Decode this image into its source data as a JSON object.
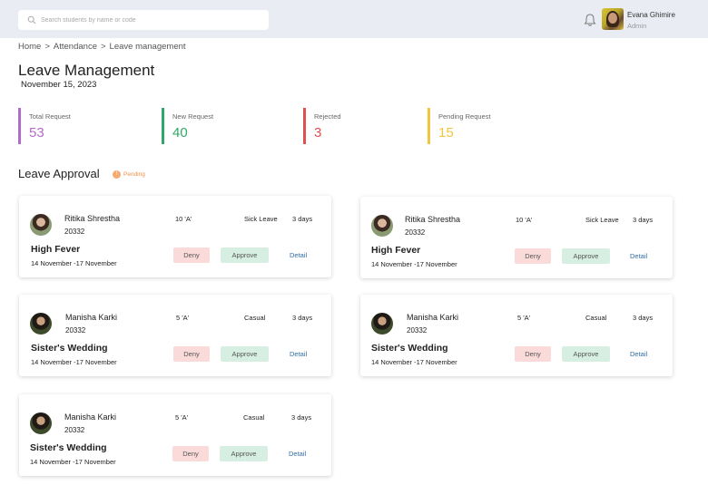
{
  "search": {
    "placeholder": "Search students by name or code"
  },
  "user": {
    "name": "Evana Ghimire",
    "role": "Admin"
  },
  "breadcrumb": [
    "Home",
    ">",
    "Attendance",
    ">",
    "Leave management"
  ],
  "page": {
    "title": "Leave Management",
    "date": "November 15, 2023"
  },
  "stats": [
    {
      "label": "Total Request",
      "value": "53",
      "color": "#b36bc9"
    },
    {
      "label": "New Request",
      "value": "40",
      "color": "#2fa86a"
    },
    {
      "label": "Rejected",
      "value": "3",
      "color": "#e0504f"
    },
    {
      "label": "Pending Request",
      "value": "15",
      "color": "#f0c63c"
    }
  ],
  "section": {
    "title": "Leave Approval",
    "badge_count": "!",
    "badge_label": "Pending"
  },
  "cards": [
    {
      "name": "Ritika Shrestha",
      "id": "20332",
      "class": "10 'A'",
      "type": "Sick Leave",
      "days": "3 days",
      "reason": "High Fever",
      "dates": "14 November -17 November",
      "deny": "Deny",
      "approve": "Approve",
      "detail": "Detail"
    },
    {
      "name": "Ritika Shrestha",
      "id": "20332",
      "class": "10 'A'",
      "type": "Sick Leave",
      "days": "3 days",
      "reason": "High Fever",
      "dates": "14 November -17 November",
      "deny": "Deny",
      "approve": "Approve",
      "detail": "Detail"
    },
    {
      "name": "Manisha Karki",
      "id": "20332",
      "class": "5 'A'",
      "type": "Casual",
      "days": "3 days",
      "reason": "Sister's Wedding",
      "dates": "14 November -17 November",
      "deny": "Deny",
      "approve": "Approve",
      "detail": "Detail"
    },
    {
      "name": "Manisha Karki",
      "id": "20332",
      "class": "5 'A'",
      "type": "Casual",
      "days": "3 days",
      "reason": "Sister's Wedding",
      "dates": "14 November -17 November",
      "deny": "Deny",
      "approve": "Approve",
      "detail": "Detail"
    },
    {
      "name": "Manisha Karki",
      "id": "20332",
      "class": "5 'A'",
      "type": "Casual",
      "days": "3 days",
      "reason": "Sister's Wedding",
      "dates": "14 November -17 November",
      "deny": "Deny",
      "approve": "Approve",
      "detail": "Detail"
    }
  ]
}
